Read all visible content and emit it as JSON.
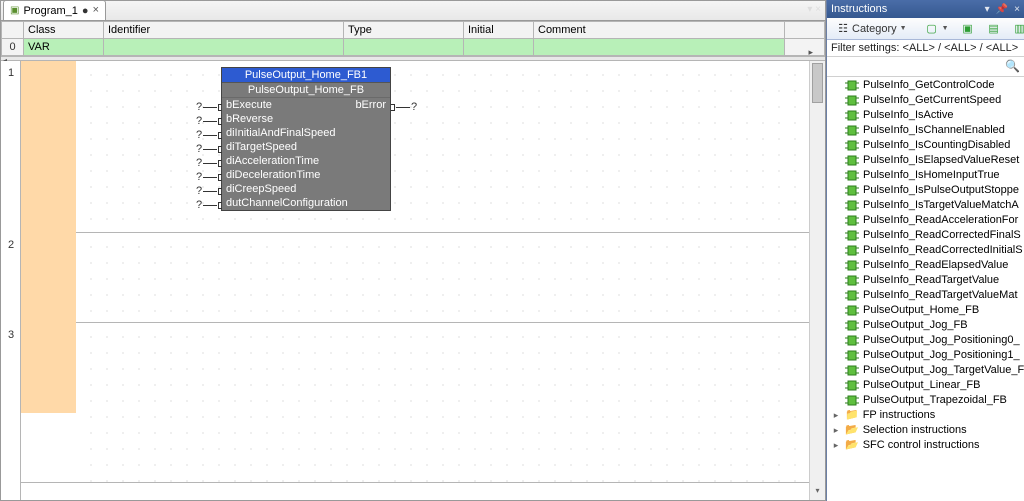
{
  "tab": {
    "title": "Program_1",
    "dirty": "●"
  },
  "vargrid": {
    "headers": {
      "class": "Class",
      "identifier": "Identifier",
      "type": "Type",
      "initial": "Initial",
      "comment": "Comment"
    },
    "row0": {
      "num": "0",
      "class": "VAR",
      "identifier": "",
      "type": "",
      "initial": "",
      "comment": ""
    }
  },
  "fb": {
    "instance": "PulseOutput_Home_FB1",
    "type": "PulseOutput_Home_FB",
    "ins": [
      "bExecute",
      "bReverse",
      "diInitialAndFinalSpeed",
      "diTargetSpeed",
      "diAccelerationTime",
      "diDecelerationTime",
      "diCreepSpeed",
      "dutChannelConfiguration"
    ],
    "outs": [
      "bError"
    ]
  },
  "rungs": [
    "1",
    "2",
    "3"
  ],
  "panel": {
    "title": "Instructions",
    "toolbar": {
      "category": "Category"
    },
    "filter": "Filter settings: <ALL> / <ALL> / <ALL>",
    "items": [
      "PulseInfo_GetControlCode",
      "PulseInfo_GetCurrentSpeed",
      "PulseInfo_IsActive",
      "PulseInfo_IsChannelEnabled",
      "PulseInfo_IsCountingDisabled",
      "PulseInfo_IsElapsedValueReset",
      "PulseInfo_IsHomeInputTrue",
      "PulseInfo_IsPulseOutputStoppe",
      "PulseInfo_IsTargetValueMatchA",
      "PulseInfo_ReadAccelerationFor",
      "PulseInfo_ReadCorrectedFinalS",
      "PulseInfo_ReadCorrectedInitialS",
      "PulseInfo_ReadElapsedValue",
      "PulseInfo_ReadTargetValue",
      "PulseInfo_ReadTargetValueMat",
      "PulseOutput_Home_FB",
      "PulseOutput_Jog_FB",
      "PulseOutput_Jog_Positioning0_",
      "PulseOutput_Jog_Positioning1_",
      "PulseOutput_Jog_TargetValue_F",
      "PulseOutput_Linear_FB",
      "PulseOutput_Trapezoidal_FB"
    ],
    "folders": [
      "FP instructions",
      "Selection instructions",
      "SFC control instructions"
    ]
  }
}
